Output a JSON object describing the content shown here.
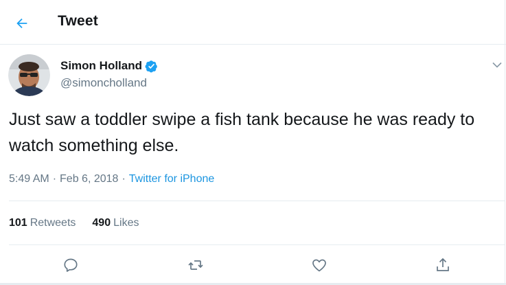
{
  "header": {
    "title": "Tweet",
    "back_icon": "arrow-left-icon",
    "accent_color": "#1da1f2"
  },
  "tweet": {
    "author": {
      "name": "Simon Holland",
      "handle": "@simoncholland",
      "verified": true,
      "verified_icon": "verified-badge-icon",
      "avatar_icon": "avatar-photo"
    },
    "text": "Just saw a toddler swipe a fish tank because he was ready to watch something else.",
    "time": "5:49 AM",
    "date": "Feb 6, 2018",
    "separator": "·",
    "source": "Twitter for iPhone",
    "menu_icon": "chevron-down-icon"
  },
  "stats": {
    "retweets": {
      "count": "101",
      "label": "Retweets"
    },
    "likes": {
      "count": "490",
      "label": "Likes"
    }
  },
  "actions": [
    {
      "name": "reply",
      "icon": "reply-icon"
    },
    {
      "name": "retweet",
      "icon": "retweet-icon"
    },
    {
      "name": "like",
      "icon": "heart-icon"
    },
    {
      "name": "share",
      "icon": "share-icon"
    }
  ],
  "colors": {
    "text_primary": "#14171a",
    "text_secondary": "#657786",
    "link": "#1b95e0",
    "divider": "#e6ecf0"
  }
}
